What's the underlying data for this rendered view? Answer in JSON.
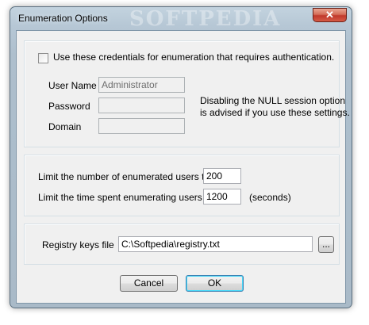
{
  "window": {
    "title": "Enumeration Options",
    "watermark": "SOFTPEDIA",
    "close_glyph": "✕"
  },
  "credentials": {
    "checkbox_label": "Use these credentials for enumeration that requires authentication.",
    "checked": false,
    "username_label": "User Name",
    "username_value": "Administrator",
    "password_label": "Password",
    "password_value": "",
    "domain_label": "Domain",
    "domain_value": "",
    "note_line1": "Disabling the NULL session option",
    "note_line2": "is advised if you use these settings."
  },
  "limits": {
    "users_label": "Limit the number of enumerated users to",
    "users_value": "200",
    "time_label": "Limit the time spent enumerating users to",
    "time_value": "1200",
    "time_unit": "(seconds)"
  },
  "registry": {
    "label": "Registry keys file",
    "value": "C:\\Softpedia\\registry.txt",
    "browse_label": "..."
  },
  "buttons": {
    "cancel": "Cancel",
    "ok": "OK"
  }
}
